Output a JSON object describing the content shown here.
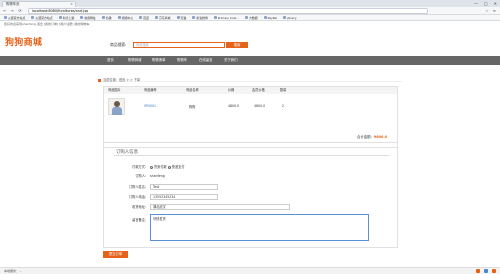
{
  "browser": {
    "tab_title": "购物车页",
    "address": "localhost:8080/furnitures/cart.jsp",
    "window_controls": [
      "—",
      "□",
      "✕"
    ],
    "nav_icons": [
      "←",
      "→",
      "⟳"
    ],
    "bookmarks": [
      "火狐官方站点",
      "火狐官方站点",
      "新手上路",
      "常用网址",
      "谷歌",
      "视频中心",
      "百度",
      "京东商城",
      "天猫",
      "新浪微博",
      "Primary Colo...",
      "大数据",
      "PayPal",
      "jQuery"
    ]
  },
  "top_links": "您好欢迎来到shanfeng 退出 [我的订单] [用户注册] 我的购物车",
  "header": {
    "logo": "狗狗商城",
    "search_label": "商品搜索:",
    "search_placeholder": "商品搜索",
    "search_button": "搜索"
  },
  "main_nav": [
    "首页",
    "购物商城",
    "购物清单",
    "购物车",
    "在线留言",
    "关于我们"
  ],
  "breadcrumb": "当前位置：首页 > > 下单",
  "cart": {
    "columns": [
      "商品图片",
      "商品编号",
      "商品名称",
      "价格",
      "会员价格",
      "数量"
    ],
    "rows": [
      {
        "id": "SP0001",
        "name": "狗狗",
        "price": "4800.0",
        "member_price": "4800.0",
        "qty": "2"
      }
    ],
    "total_label": "合计金额：",
    "total_value": "9600.0"
  },
  "order": {
    "title": "订购人信息",
    "pay_label": "付款方式:",
    "pay_options": [
      "货到付款",
      "快递支付"
    ],
    "user_label": "订购人:",
    "user_value": "shanfeng",
    "name_label": "订购人姓名:",
    "name_value": "Test",
    "phone_label": "订购人电话:",
    "phone_value": "13552345234",
    "address_label": "收货地址:",
    "address_value": "湖北武汉",
    "note_label": "留言备注:",
    "note_value": "尽快发货",
    "submit": "提交订单"
  },
  "status_bar": "本地服务：..."
}
